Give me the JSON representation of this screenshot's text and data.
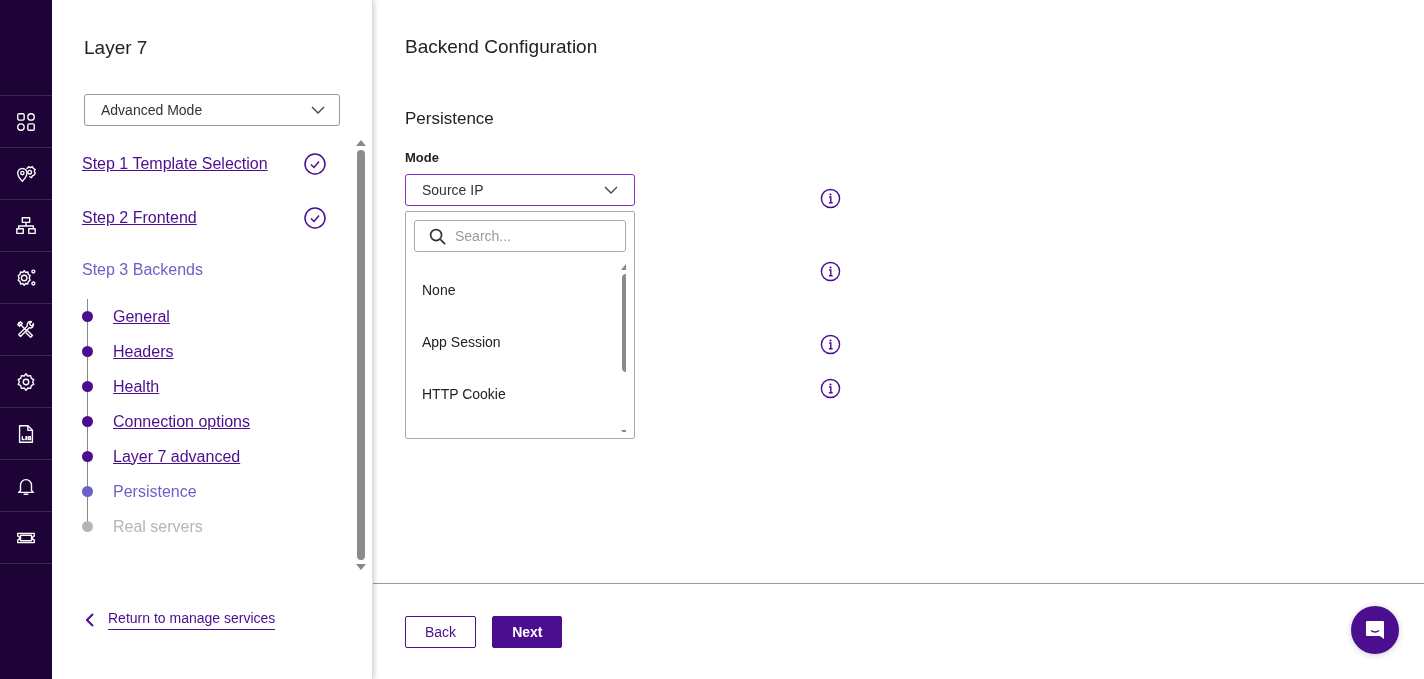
{
  "sidebar": {
    "title": "Layer 7",
    "mode_select": {
      "value": "Advanced Mode"
    },
    "steps": [
      {
        "label": "Step 1 Template Selection",
        "checked": true,
        "selected": false
      },
      {
        "label": "Step 2 Frontend",
        "checked": true,
        "selected": false
      },
      {
        "label": "Step 3 Backends",
        "checked": false,
        "selected": true,
        "children": [
          {
            "label": "General",
            "checked": true,
            "selected": false
          },
          {
            "label": "Headers",
            "checked": true,
            "selected": false
          },
          {
            "label": "Health",
            "checked": true,
            "selected": false
          },
          {
            "label": "Connection options",
            "checked": true,
            "selected": false
          },
          {
            "label": "Layer 7 advanced",
            "checked": true,
            "selected": false
          },
          {
            "label": "Persistence",
            "checked": false,
            "selected": true
          },
          {
            "label": "Real servers",
            "checked": false,
            "selected": false
          }
        ]
      }
    ],
    "return_link": "Return to manage services"
  },
  "main": {
    "title": "Backend Configuration",
    "section": "Persistence",
    "mode_label": "Mode",
    "mode_select": {
      "value": "Source IP",
      "expanded": true,
      "search": {
        "placeholder": "Search..."
      },
      "options": [
        "None",
        "App Session",
        "HTTP Cookie"
      ]
    }
  },
  "footer": {
    "buttons": [
      {
        "label": "Back",
        "kind": "secondary"
      },
      {
        "label": "Next",
        "kind": "primary"
      }
    ]
  }
}
